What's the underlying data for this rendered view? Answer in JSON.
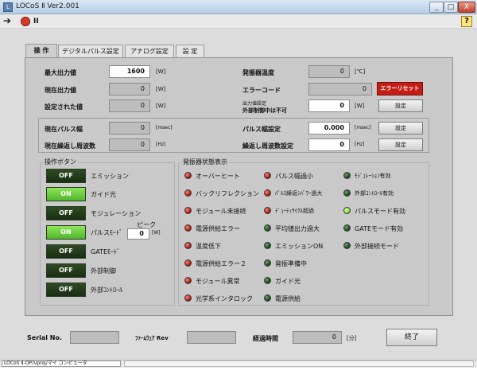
{
  "window": {
    "title": "LOCoS Ⅱ Ver2.001",
    "app_icon": "app-icon",
    "controls": [
      "_",
      "□",
      "X"
    ]
  },
  "toolbar": {
    "run_icon": "arrow-right-icon",
    "stop_icon": "stop-icon",
    "pause_icon": "pause-icon",
    "pause_glyph": "II",
    "help_glyph": "?"
  },
  "tabs": [
    "操 作",
    "デジタルパルス設定",
    "アナログ設定",
    "設 定"
  ],
  "output": {
    "max_output_label": "最大出力値",
    "max_output_value": "1600",
    "max_output_unit": "[W]",
    "current_output_label": "現在出力値",
    "current_output_value": "0",
    "current_output_unit": "[W]",
    "set_value_label": "設定された値",
    "set_value_value": "0",
    "set_value_unit": "[W]",
    "temp_label": "発振器温度",
    "temp_value": "0",
    "temp_unit": "[℃]",
    "error_code_label": "エラーコード",
    "error_code_value": "0",
    "error_reset_label": "エラーリセット",
    "output_setting_label_1": "出力値設定",
    "output_setting_label_2": "外部制御中は不可",
    "output_setting_value": "0",
    "output_setting_unit": "[W]",
    "output_setting_button": "設定"
  },
  "pulse": {
    "current_pulse_width_label": "現在パルス幅",
    "current_pulse_width_value": "0",
    "current_pulse_width_unit": "[msec]",
    "current_rep_freq_label": "現在繰返し周波数",
    "current_rep_freq_value": "0",
    "current_rep_freq_unit": "[Hz]",
    "pulse_width_set_label": "パルス幅設定",
    "pulse_width_set_value": "0.000",
    "pulse_width_set_unit": "[msec]",
    "rep_freq_set_label": "繰返し周波数設定",
    "rep_freq_set_value": "0",
    "rep_freq_set_unit": "[Hz]",
    "set_button": "設定"
  },
  "op_buttons": {
    "title": "操作ボタン",
    "items": [
      {
        "state": "OFF",
        "label": "エミッション"
      },
      {
        "state": "ON",
        "label": "ガイド光"
      },
      {
        "state": "OFF",
        "label": "モジュレーション"
      },
      {
        "state": "ON",
        "label": "パルスﾓｰﾄﾞ"
      },
      {
        "state": "OFF",
        "label": "GATEﾓｰﾄﾞ"
      },
      {
        "state": "OFF",
        "label": "外部制御"
      },
      {
        "state": "OFF",
        "label": "外部ｺﾝﾄﾛｰﾙ"
      }
    ],
    "peak_label": "ピーク",
    "peak_value": "0",
    "peak_unit": "[W]"
  },
  "status": {
    "title": "発振器状態表示",
    "col1": [
      {
        "color": "red",
        "label": "オーバーヒート"
      },
      {
        "color": "red",
        "label": "バックリフレクション"
      },
      {
        "color": "red",
        "label": "モジュール未接続"
      },
      {
        "color": "red",
        "label": "電源供給エラー"
      },
      {
        "color": "red",
        "label": "温度低下"
      },
      {
        "color": "red",
        "label": "電源供給エラー２"
      },
      {
        "color": "red",
        "label": "モジュール異常"
      },
      {
        "color": "red",
        "label": "光学系インタロック"
      }
    ],
    "col2": [
      {
        "color": "red",
        "label": "パルス幅過小"
      },
      {
        "color": "red",
        "label": "ﾊﾟﾙｽ繰返ｼﾊﾟﾜｰ過大"
      },
      {
        "color": "red",
        "label": "ﾃﾞｭｰﾃｨｻｲｸﾙ超過"
      },
      {
        "color": "green",
        "label": "平均値出力過大"
      },
      {
        "color": "green",
        "label": "エミッションON"
      },
      {
        "color": "green",
        "label": "発振準備中"
      },
      {
        "color": "green",
        "label": "ガイド光"
      },
      {
        "color": "green",
        "label": "電源供給"
      }
    ],
    "col3": [
      {
        "color": "green",
        "label": "ﾓｼﾞｭﾚｰｼｮﾝ有効"
      },
      {
        "color": "green",
        "label": "外部ｺﾝﾄﾛｰﾙ有効"
      },
      {
        "color": "lit",
        "label": "パルスモード有効"
      },
      {
        "color": "green",
        "label": "GATEモード有効"
      },
      {
        "color": "green",
        "label": "外部接続モード"
      }
    ]
  },
  "footer": {
    "serial_label": "Serial No.",
    "firmware_label": "ﾌｧｰﾑｳｪｱ Rev",
    "elapsed_label": "経過時間",
    "elapsed_value": "0",
    "elapsed_unit": "[分]",
    "exit_button": "終了"
  },
  "taskbar": {
    "label": "LOCoS Ⅱ-OP.lvproj/マイ コンピュータ"
  }
}
